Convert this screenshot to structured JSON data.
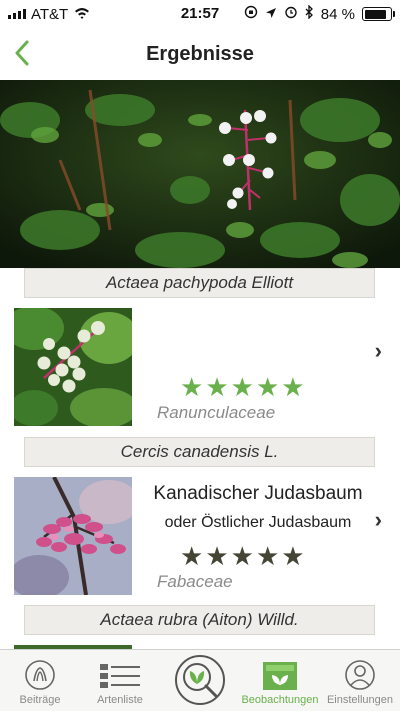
{
  "status_bar": {
    "carrier": "AT&T",
    "time": "21:57",
    "battery_text": "84 %",
    "battery_level": 0.84
  },
  "nav": {
    "title": "Ergebnisse",
    "back_icon": "chevron-left-icon"
  },
  "results": [
    {
      "scientific_name": "Actaea pachypoda Elliott",
      "common_names": [],
      "family": "Ranunculaceae",
      "rating": 5,
      "star_color": "#6ab04c"
    },
    {
      "scientific_name": "Cercis canadensis L.",
      "common_names": [
        "Kanadischer Judasbaum",
        "oder Östlicher Judasbaum"
      ],
      "family": "Fabaceae",
      "rating": 5,
      "star_color": "#454535"
    },
    {
      "scientific_name": "Actaea rubra (Aiton) Willd."
    }
  ],
  "tabbar": {
    "tabs": [
      {
        "label": "Beiträge",
        "icon": "posts-icon"
      },
      {
        "label": "Artenliste",
        "icon": "species-list-icon"
      },
      {
        "label": "",
        "icon": "identify-leaf-search-icon"
      },
      {
        "label": "Beobachtungen",
        "icon": "observations-icon",
        "active": true
      },
      {
        "label": "Einstellungen",
        "icon": "settings-profile-icon"
      }
    ]
  },
  "colors": {
    "accent": "#6ab04c",
    "banner_bg": "#eeedea"
  }
}
